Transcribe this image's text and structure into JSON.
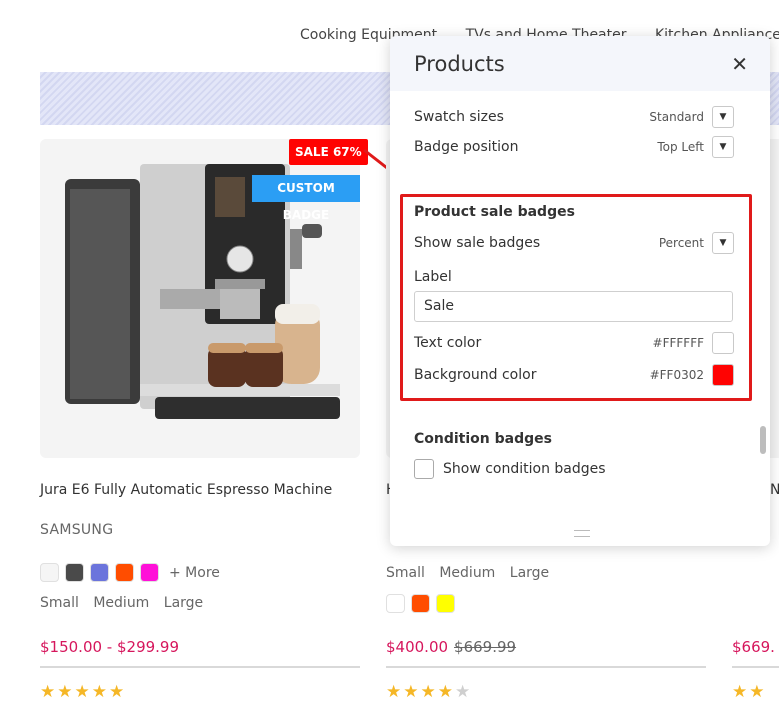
{
  "nav": [
    "Cooking Equipment",
    "TVs and Home Theater",
    "Kitchen Appliances"
  ],
  "product1": {
    "sale_badge": "SALE  67%",
    "custom_badge": "CUSTOM BADGE",
    "title": "Jura E6 Fully Automatic Espresso Machine",
    "brand": "SAMSUNG",
    "swatch_colors": [
      "#f5f5f5",
      "#4a4a4a",
      "#6b74dc",
      "#ff4d00",
      "#ff10d8"
    ],
    "more": "+ More",
    "sizes": [
      "Small",
      "Medium",
      "Large"
    ],
    "price": "$150.00 - $299.99",
    "rating": 5
  },
  "product2": {
    "title_initial": "H",
    "sizes": [
      "Small",
      "Medium",
      "Large"
    ],
    "swatch_colors": [
      "#ffffff",
      "#ff4d00",
      "#ffff00"
    ],
    "price": "$400.00",
    "old_price": "$669.99",
    "rating": 4
  },
  "product3": {
    "title_initial": "N",
    "price": "$669.",
    "rating": 2
  },
  "panel": {
    "title": "Products",
    "swatch_sizes": {
      "label": "Swatch sizes",
      "value": "Standard"
    },
    "badge_position": {
      "label": "Badge position",
      "value": "Top Left"
    },
    "sale_section": {
      "heading": "Product sale badges",
      "show": {
        "label": "Show sale badges",
        "value": "Percent"
      },
      "label_title": "Label",
      "label_value": "Sale",
      "text_color": {
        "label": "Text color",
        "value": "#FFFFFF",
        "swatch": "#FFFFFF"
      },
      "bg_color": {
        "label": "Background color",
        "value": "#FF0302",
        "swatch": "#FF0302"
      }
    },
    "condition_section": {
      "heading": "Condition badges",
      "checkbox_label": "Show condition badges"
    }
  },
  "colors": {
    "price": "#d6165c",
    "accent_blue": "#2b9ef4",
    "sale_red": "#FF0302",
    "highlight": "#e01a1a"
  }
}
